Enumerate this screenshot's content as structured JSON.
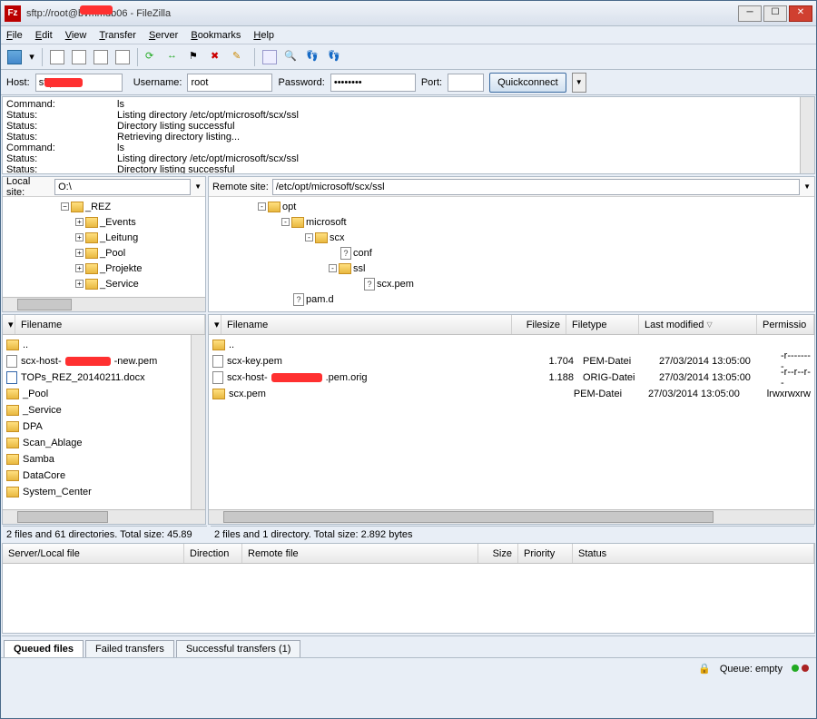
{
  "window": {
    "title": "sftp://root@bvmmdb06 - FileZilla"
  },
  "menu": [
    "File",
    "Edit",
    "View",
    "Transfer",
    "Server",
    "Bookmarks",
    "Help"
  ],
  "connect": {
    "host_label": "Host:",
    "host_value": "sftp://",
    "user_label": "Username:",
    "user_value": "root",
    "pass_label": "Password:",
    "pass_value": "••••••••",
    "port_label": "Port:",
    "port_value": "",
    "quick": "Quickconnect"
  },
  "log": [
    {
      "lab": "Command:",
      "msg": "ls"
    },
    {
      "lab": "Status:",
      "msg": "Listing directory /etc/opt/microsoft/scx/ssl"
    },
    {
      "lab": "Status:",
      "msg": "Directory listing successful"
    },
    {
      "lab": "Status:",
      "msg": "Retrieving directory listing..."
    },
    {
      "lab": "Command:",
      "msg": "ls"
    },
    {
      "lab": "Status:",
      "msg": "Listing directory /etc/opt/microsoft/scx/ssl"
    },
    {
      "lab": "Status:",
      "msg": "Directory listing successful"
    }
  ],
  "local": {
    "site_label": "Local site:",
    "site_value": "O:\\",
    "tree": [
      "_REZ",
      "_Events",
      "_Leitung",
      "_Pool",
      "_Projekte",
      "_Service"
    ],
    "cols": {
      "filename": "Filename"
    },
    "files": [
      {
        "name": "..",
        "type": "folder"
      },
      {
        "name": "scx-host-",
        "redact": true,
        "suffix": "-new.pem",
        "type": "file"
      },
      {
        "name": "TOPs_REZ_20140211.docx",
        "type": "docx"
      },
      {
        "name": "_Pool",
        "type": "folder"
      },
      {
        "name": "_Service",
        "type": "folder"
      },
      {
        "name": "DPA",
        "type": "folder"
      },
      {
        "name": "Scan_Ablage",
        "type": "folder"
      },
      {
        "name": "Samba",
        "type": "folder"
      },
      {
        "name": "DataCore",
        "type": "folder"
      },
      {
        "name": "System_Center",
        "type": "folder"
      }
    ],
    "status": "2 files and 61 directories. Total size: 45.89"
  },
  "remote": {
    "site_label": "Remote site:",
    "site_value": "/etc/opt/microsoft/scx/ssl",
    "tree": [
      {
        "name": "opt",
        "indent": 0,
        "exp": "-",
        "icon": "fld"
      },
      {
        "name": "microsoft",
        "indent": 1,
        "exp": "-",
        "icon": "fld"
      },
      {
        "name": "scx",
        "indent": 2,
        "exp": "-",
        "icon": "fld"
      },
      {
        "name": "conf",
        "indent": 3,
        "exp": "",
        "icon": "q"
      },
      {
        "name": "ssl",
        "indent": 3,
        "exp": "-",
        "icon": "fld"
      },
      {
        "name": "scx.pem",
        "indent": 4,
        "exp": "",
        "icon": "q"
      },
      {
        "name": "pam.d",
        "indent": 1,
        "exp": "",
        "icon": "q"
      }
    ],
    "cols": {
      "filename": "Filename",
      "filesize": "Filesize",
      "filetype": "Filetype",
      "modified": "Last modified",
      "perm": "Permissio"
    },
    "files": [
      {
        "name": "..",
        "size": "",
        "type": "",
        "mod": "",
        "perm": ""
      },
      {
        "name": "scx-key.pem",
        "size": "1.704",
        "type": "PEM-Datei",
        "mod": "27/03/2014 13:05:00",
        "perm": "-r--------"
      },
      {
        "name": "scx-host-",
        "redact": true,
        "suffix": ".pem.orig",
        "size": "1.188",
        "type": "ORIG-Datei",
        "mod": "27/03/2014 13:05:00",
        "perm": "-r--r--r--"
      },
      {
        "name": "scx.pem",
        "size": "",
        "type": "PEM-Datei",
        "mod": "27/03/2014 13:05:00",
        "perm": "lrwxrwxrw"
      }
    ],
    "status": "2 files and 1 directory. Total size: 2.892 bytes"
  },
  "queue": {
    "cols": [
      "Server/Local file",
      "Direction",
      "Remote file",
      "Size",
      "Priority",
      "Status"
    ]
  },
  "tabs": [
    "Queued files",
    "Failed transfers",
    "Successful transfers (1)"
  ],
  "bottom": {
    "queue": "Queue: empty"
  }
}
